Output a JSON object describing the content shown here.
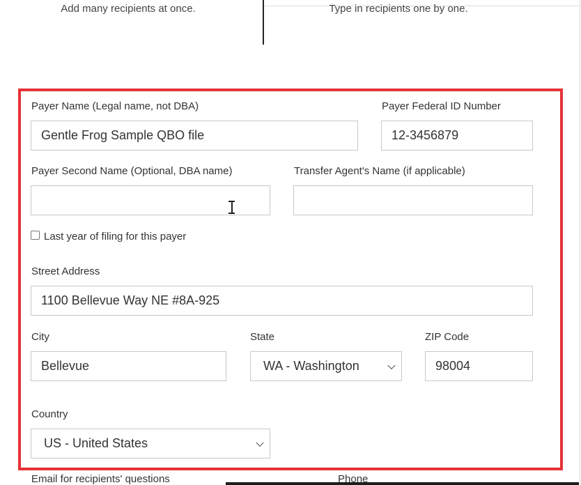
{
  "options": {
    "bulk_desc": "Add many recipients at once.",
    "manual_desc": "Type in recipients one by one."
  },
  "form": {
    "payer_name": {
      "label": "Payer Name (Legal name, not DBA)",
      "value": "Gentle Frog Sample QBO file"
    },
    "payer_federal_id": {
      "label": "Payer Federal ID Number",
      "value": "12-3456879"
    },
    "payer_second_name": {
      "label": "Payer Second Name (Optional, DBA name)",
      "value": ""
    },
    "transfer_agent": {
      "label": "Transfer Agent's Name (if applicable)",
      "value": ""
    },
    "last_year": {
      "label": "Last year of filing for this payer",
      "checked": false
    },
    "street": {
      "label": "Street Address",
      "value": "1100 Bellevue Way NE #8A-925"
    },
    "city": {
      "label": "City",
      "value": "Bellevue"
    },
    "state": {
      "label": "State",
      "value": "WA - Washington"
    },
    "zip": {
      "label": "ZIP Code",
      "value": "98004"
    },
    "country": {
      "label": "Country",
      "value": "US - United States"
    },
    "email": {
      "label": "Email for recipients' questions"
    },
    "phone": {
      "label": "Phone"
    }
  },
  "colors": {
    "highlight": "#e53238",
    "border": "#c8c8c8"
  },
  "icons": {
    "text_cursor": "i-beam-cursor-icon",
    "select_arrow": "chevron-down-icon"
  }
}
